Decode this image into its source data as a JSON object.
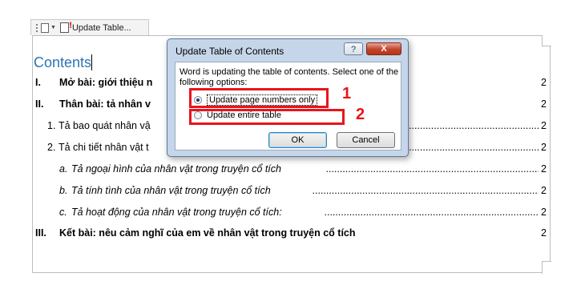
{
  "content_control": {
    "label": "Update Table..."
  },
  "document": {
    "heading": "Contents",
    "toc": [
      {
        "num": "I.",
        "text": "Mở bài: giới thiệu n",
        "page": "2"
      },
      {
        "num": "II.",
        "text": "Thân bài: tả nhân v",
        "page": "2"
      },
      {
        "num": "1.",
        "text": "Tả bao quát nhân vậ",
        "page": "2"
      },
      {
        "num": "2.",
        "text": "Tả chi tiết nhân vật t",
        "page": "2"
      },
      {
        "num": "a.",
        "text": "Tả ngoại hình của nhân vật trong truyện cổ tích",
        "page": "2"
      },
      {
        "num": "b.",
        "text": "Tả tính tình của nhân vật trong truyện cổ tích",
        "page": "2"
      },
      {
        "num": "c.",
        "text": "Tả hoạt động của nhân vật trong truyện cổ tích:",
        "page": "2"
      },
      {
        "num": "III.",
        "text": "Kết bài: nêu cảm nghĩ của em về nhân vật trong truyện cổ tích",
        "page": "2"
      }
    ]
  },
  "dialog": {
    "title": "Update Table of Contents",
    "help_label": "?",
    "close_label": "X",
    "message": "Word is updating the table of contents.  Select one of the following options:",
    "options": [
      {
        "label": "Update page numbers only",
        "selected": true
      },
      {
        "label": "Update entire table",
        "selected": false
      }
    ],
    "ok_label": "OK",
    "cancel_label": "Cancel"
  },
  "annotations": {
    "label_1": "1",
    "label_2": "2",
    "color": "#e8141c"
  }
}
